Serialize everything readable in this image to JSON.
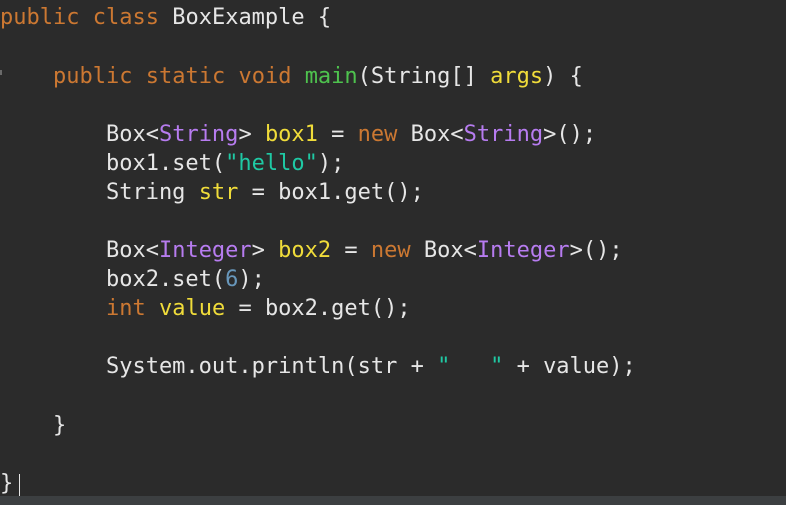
{
  "editor": {
    "lines": [
      [
        {
          "t": "public",
          "c": "keyword"
        },
        {
          "t": " ",
          "c": "plain"
        },
        {
          "t": "class",
          "c": "keyword"
        },
        {
          "t": " BoxExample {",
          "c": "plain"
        }
      ],
      [
        {
          "t": "    ",
          "c": "plain"
        },
        {
          "t": "public",
          "c": "keyword"
        },
        {
          "t": " ",
          "c": "plain"
        },
        {
          "t": "static",
          "c": "keyword"
        },
        {
          "t": " ",
          "c": "plain"
        },
        {
          "t": "void",
          "c": "keyword"
        },
        {
          "t": " ",
          "c": "plain"
        },
        {
          "t": "main",
          "c": "method"
        },
        {
          "t": "(String[] ",
          "c": "plain"
        },
        {
          "t": "args",
          "c": "var"
        },
        {
          "t": ") {",
          "c": "plain"
        }
      ],
      [
        {
          "t": "        Box<",
          "c": "plain"
        },
        {
          "t": "String",
          "c": "type"
        },
        {
          "t": "> ",
          "c": "plain"
        },
        {
          "t": "box1",
          "c": "var"
        },
        {
          "t": " = ",
          "c": "plain"
        },
        {
          "t": "new",
          "c": "keyword"
        },
        {
          "t": " Box<",
          "c": "plain"
        },
        {
          "t": "String",
          "c": "type"
        },
        {
          "t": ">();",
          "c": "plain"
        }
      ],
      [
        {
          "t": "        box1.set(",
          "c": "plain"
        },
        {
          "t": "\"hello\"",
          "c": "string"
        },
        {
          "t": ");",
          "c": "plain"
        }
      ],
      [
        {
          "t": "        String ",
          "c": "plain"
        },
        {
          "t": "str",
          "c": "var"
        },
        {
          "t": " = box1.get();",
          "c": "plain"
        }
      ],
      [
        {
          "t": "        Box<",
          "c": "plain"
        },
        {
          "t": "Integer",
          "c": "type"
        },
        {
          "t": "> ",
          "c": "plain"
        },
        {
          "t": "box2",
          "c": "var"
        },
        {
          "t": " = ",
          "c": "plain"
        },
        {
          "t": "new",
          "c": "keyword"
        },
        {
          "t": " Box<",
          "c": "plain"
        },
        {
          "t": "Integer",
          "c": "type"
        },
        {
          "t": ">();",
          "c": "plain"
        }
      ],
      [
        {
          "t": "        box2.set(",
          "c": "plain"
        },
        {
          "t": "6",
          "c": "number"
        },
        {
          "t": ");",
          "c": "plain"
        }
      ],
      [
        {
          "t": "        ",
          "c": "plain"
        },
        {
          "t": "int",
          "c": "keyword"
        },
        {
          "t": " ",
          "c": "plain"
        },
        {
          "t": "value",
          "c": "var"
        },
        {
          "t": " = box2.get();",
          "c": "plain"
        }
      ],
      [
        {
          "t": "        System.out.println(str + ",
          "c": "plain"
        },
        {
          "t": "\"   \"",
          "c": "string"
        },
        {
          "t": " + value);",
          "c": "plain"
        }
      ],
      [
        {
          "t": "    }",
          "c": "plain"
        }
      ],
      [
        {
          "t": "}",
          "c": "plain"
        }
      ]
    ]
  },
  "colors": {
    "background": "#2b2b2b",
    "keyword": "#cc7832",
    "method": "#4ec24e",
    "variable": "#f0dc3a",
    "type": "#b77cf0",
    "string": "#1fc9a4",
    "number": "#6897bb",
    "plain": "#e6e6e6"
  }
}
